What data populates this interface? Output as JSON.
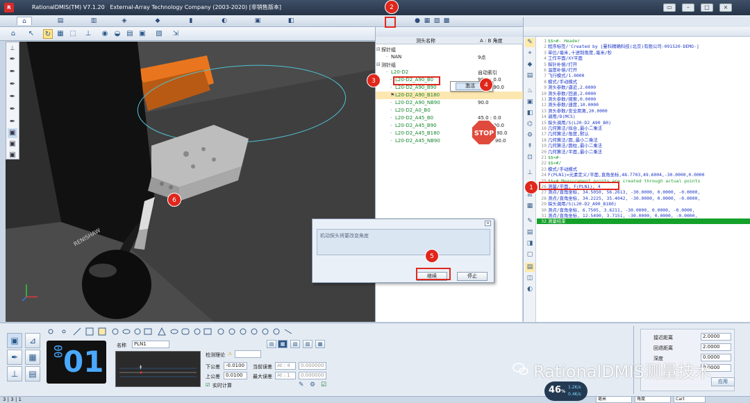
{
  "titlebar": {
    "app": "RationalDMIS(TM) V7.1.20",
    "company": "External-Array Technology Company (2003-2020)",
    "edition": "[非销售版本]"
  },
  "probe_panel": {
    "col_name": "测头名称",
    "col_angle": "A : B 角度",
    "tree": [
      {
        "name": "探针组",
        "value": ""
      },
      {
        "name": "NAN",
        "value": "9点"
      },
      {
        "name": "测针组",
        "value": ""
      },
      {
        "name": "L20-D2",
        "value": "自动索引"
      },
      {
        "name": "L20-D2_A90_B0",
        "value": "90.0 : 0.0"
      },
      {
        "name": "L20-D2_A90_B90",
        "value": "90.0 : 90.0"
      },
      {
        "name": "L20-D2_A90_B180",
        "value": ""
      },
      {
        "name": "L20-D2_A90_NB90",
        "value": "90.0"
      },
      {
        "name": "L20-D2_A0_B0",
        "value": ""
      },
      {
        "name": "L20-D2_A45_B0",
        "value": "45.0 : 0.0"
      },
      {
        "name": "L20-D2_A45_B90",
        "value": "45.0 : 90.0"
      },
      {
        "name": "L20-D2_A45_B180",
        "value": "45.0 : 180.0"
      },
      {
        "name": "L20-D2_A45_NB90",
        "value": "45.0 : -90.0"
      }
    ],
    "context_menu": "激活"
  },
  "stop_sign": "STOP",
  "program": {
    "lines": [
      {
        "n": "1",
        "text": "$$<#- Header",
        "type": "cmt"
      },
      {
        "n": "2",
        "text": "程序标签/'Created by [曼科精确科技(北京)有限公司-091520-DEMO-]",
        "type": ""
      },
      {
        "n": "3",
        "text": "单位/毫米,十进制角度,毫米/秒",
        "type": ""
      },
      {
        "n": "4",
        "text": "工作平面/XY平面",
        "type": ""
      },
      {
        "n": "5",
        "text": "探针补偿/打开",
        "type": ""
      },
      {
        "n": "6",
        "text": "温度补偿/打开",
        "type": ""
      },
      {
        "n": "7",
        "text": "飞行模式/1.0000",
        "type": ""
      },
      {
        "n": "8",
        "text": "模式/手动模式",
        "type": ""
      },
      {
        "n": "9",
        "text": "测头参数/逼近,2.0000",
        "type": ""
      },
      {
        "n": "10",
        "text": "测头参数/回退,2.0000",
        "type": ""
      },
      {
        "n": "11",
        "text": "测头参数/搜索,0.0000",
        "type": ""
      },
      {
        "n": "12",
        "text": "测头参数/速度,10.0000",
        "type": ""
      },
      {
        "n": "13",
        "text": "测头参数/安全距离,20.0000",
        "type": ""
      },
      {
        "n": "14",
        "text": "调用/D(MCS)",
        "type": ""
      },
      {
        "n": "15",
        "text": "探头调用/S(L20-D2_A90_B0)",
        "type": ""
      },
      {
        "n": "16",
        "text": "几何算法/拟合,最小二乘法",
        "type": ""
      },
      {
        "n": "17",
        "text": "几何算法/角度,默认",
        "type": ""
      },
      {
        "n": "18",
        "text": "几何算法/圆,最小二乘法",
        "type": ""
      },
      {
        "n": "19",
        "text": "几何算法/圆柱,最小二乘法",
        "type": ""
      },
      {
        "n": "20",
        "text": "几何算法/平面,最小二乘法",
        "type": ""
      },
      {
        "n": "21",
        "text": "$$<#-",
        "type": "cmt"
      },
      {
        "n": "22",
        "text": "$$<#/",
        "type": "cmt"
      },
      {
        "n": "23",
        "text": "模式/手动模式",
        "type": ""
      },
      {
        "n": "24",
        "text": "F(PLN1)=元素定义/平面,直角坐标,48.7703,49.6004,-30.0000,0.0000",
        "type": ""
      },
      {
        "n": "25",
        "text": "$$<# Measurement points are created through actual points",
        "type": "cmt"
      },
      {
        "n": "26",
        "text": "测量/平面, F(PLN1), 4",
        "type": ""
      },
      {
        "n": "27",
        "text": "测点/直角坐标, 34.5050, 56.2613, -30.0000, 0.0000, -0.0000,",
        "type": ""
      },
      {
        "n": "28",
        "text": "测点/直角坐标, 34.2225, 35.4042, -30.0000, 0.0000, -0.0000,",
        "type": ""
      },
      {
        "n": "29",
        "text": "探头调用/S(L20-D2_A90_B180)",
        "type": ""
      },
      {
        "n": "30",
        "text": "测点/直角坐标, 6.7505, 3.6211, -30.0000, 0.0000, -0.0000,",
        "type": ""
      },
      {
        "n": "31",
        "text": "测点/直角坐标, 12.5490, 3.7151, -30.0000, 0.0000, -0.0000,",
        "type": ""
      },
      {
        "n": "32",
        "text": "测量结束",
        "type": "cur"
      }
    ]
  },
  "dialog": {
    "message": "机动探头将要改变角度",
    "continue_btn": "继续",
    "stop_btn": "停止"
  },
  "bottom": {
    "counter_small": "00",
    "counter_big": "01",
    "name_label": "名称",
    "name_value": "PLN1",
    "detect_label": "检测理论",
    "lower_tol_label": "下公差",
    "lower_tol": "-0.0100",
    "upper_tol_label": "上公差",
    "upper_tol": "0.0100",
    "cur_err_label": "当前误差",
    "max_err_label": "最大误差",
    "at1": "At : 4",
    "at2": "At : 1",
    "zero1": "0.000000",
    "zero2": "0.000000",
    "realtime": "实时计算"
  },
  "right_params": [
    {
      "label": "接近距离",
      "value": "2.0000"
    },
    {
      "label": "回退距离",
      "value": "2.0000"
    },
    {
      "label": "深度",
      "value": "0.0000"
    },
    {
      "label": "",
      "value": "0.0000"
    }
  ],
  "apply_btn": "应用",
  "status": {
    "page": "3 | 3 | 1",
    "unit": "毫米",
    "angle": "角度",
    "coord": "Cart"
  },
  "gauge": {
    "value": "46",
    "unit": "%",
    "r1": "1.2K/s",
    "r2": "0.4K/s"
  },
  "watermark": "RationalDMIS测量技术",
  "markers": [
    "1",
    "2",
    "3",
    "4",
    "5",
    "6"
  ]
}
